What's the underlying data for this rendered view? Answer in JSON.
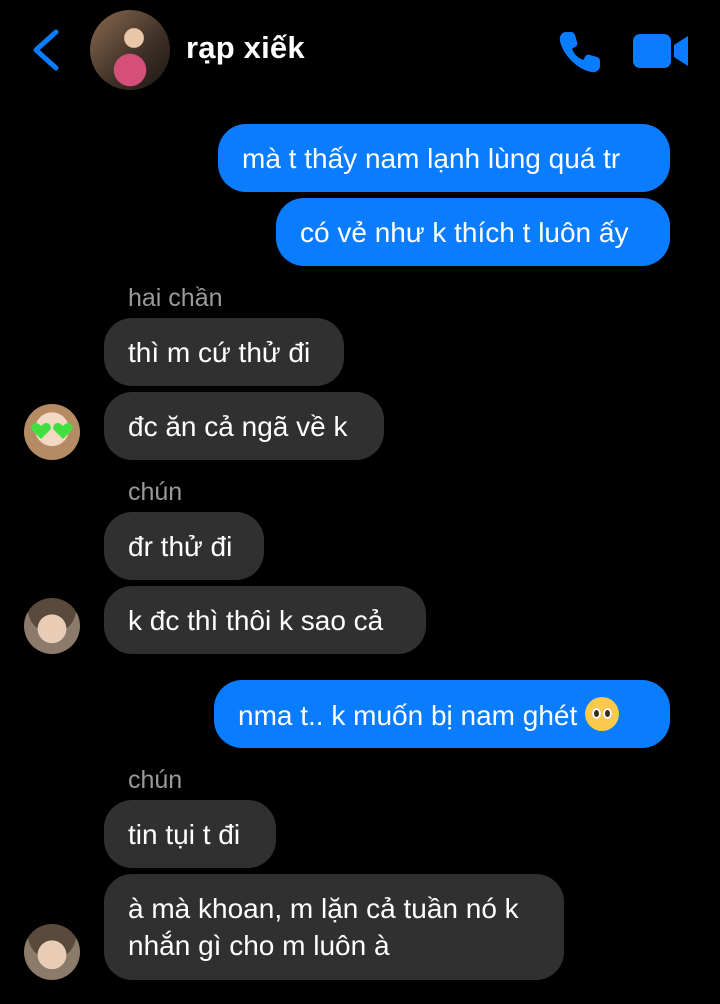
{
  "header": {
    "title": "rạp xiếk"
  },
  "icons": {
    "back": "back-chevron-icon",
    "phone": "phone-icon",
    "video": "video-camera-icon"
  },
  "colors": {
    "accent": "#0a7cff",
    "received_bubble": "#303030",
    "background": "#000000",
    "sender_name": "#9a9a9a"
  },
  "messages": [
    {
      "direction": "sent",
      "text": "mà t thấy nam lạnh lùng quá tr"
    },
    {
      "direction": "sent",
      "text": "có vẻ như k thích t luôn ấy"
    },
    {
      "direction": "received",
      "sender": "hai chần",
      "text": "thì m cứ thử đi"
    },
    {
      "direction": "received",
      "text": "đc ăn cả ngã về k"
    },
    {
      "direction": "received",
      "sender": "chún",
      "text": "đr thử đi"
    },
    {
      "direction": "received",
      "text": "k đc thì thôi k sao cả"
    },
    {
      "direction": "sent",
      "text": "nma t.. k muốn bị nam ghét",
      "emoji": "pleading-face-emoji"
    },
    {
      "direction": "received",
      "sender": "chún",
      "text": "tin tụi t đi"
    },
    {
      "direction": "received",
      "text_line1": "à mà khoan, m lặn cả tuần nó k",
      "text_line2": "nhắn gì cho m luôn à"
    }
  ]
}
